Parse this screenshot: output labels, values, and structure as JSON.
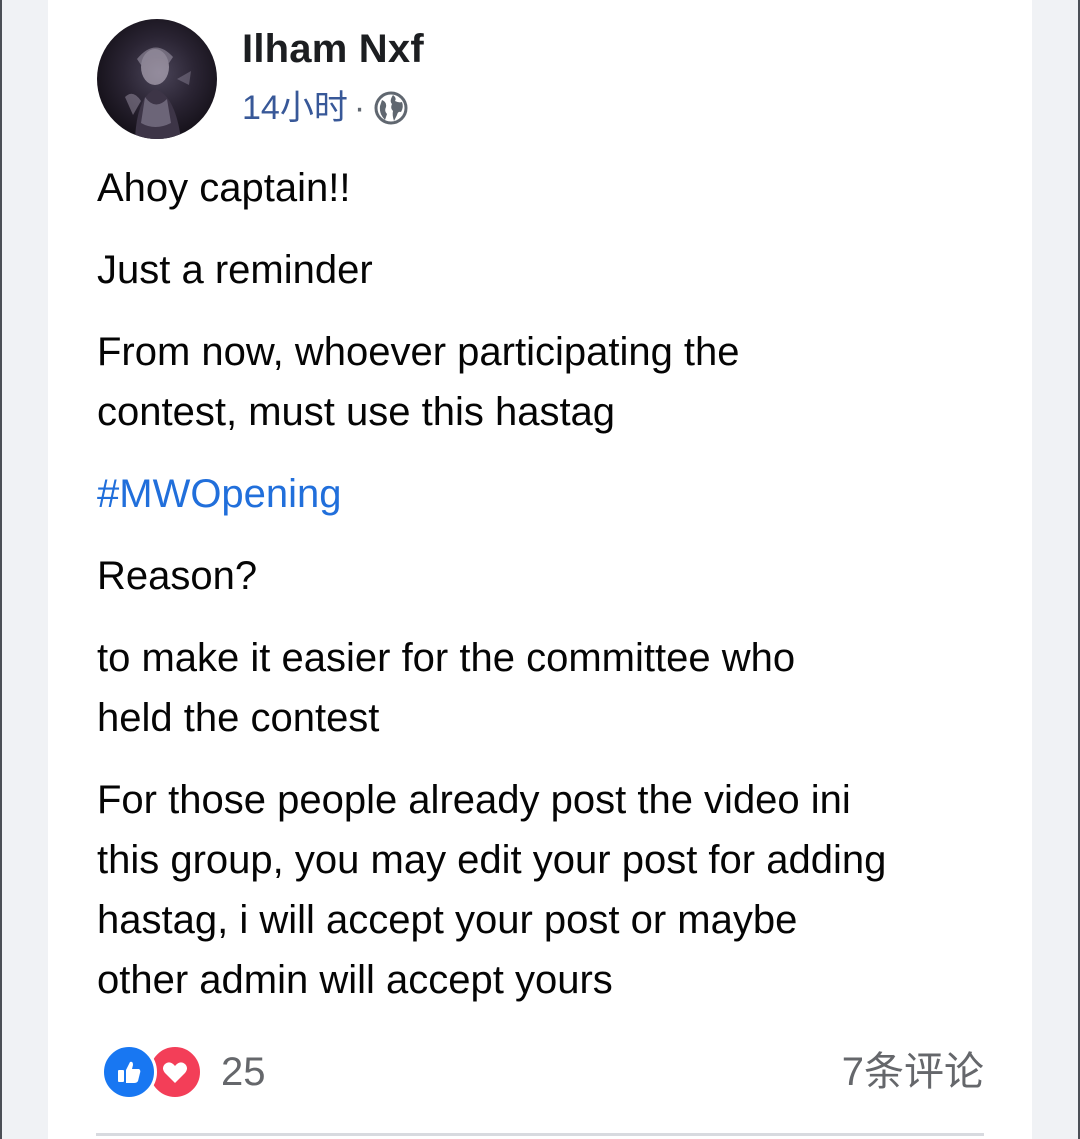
{
  "post": {
    "author": "Ilham Nxf",
    "time": "14小时",
    "separator": "·",
    "privacy_icon": "globe-icon",
    "avatar_icon": "profile-avatar",
    "paragraphs": {
      "p1": "Ahoy captain!!",
      "p2": "Just a reminder",
      "p3_line1": "From now, whoever participating the",
      "p3_line2": "contest, must use this hastag",
      "hashtag": "#MWOpening",
      "p5": "Reason?",
      "p6_line1": "to make it easier for the committee who",
      "p6_line2": "held the contest",
      "p7_line1": "For those people already post the video ini",
      "p7_line2": "this group, you may edit your post for adding",
      "p7_line3": "hastag, i will accept your post or maybe",
      "p7_line4": "other admin will accept yours"
    }
  },
  "footer": {
    "reaction_icons": [
      "like-icon",
      "love-icon"
    ],
    "reaction_count": "25",
    "comments": "7条评论"
  },
  "colors": {
    "link": "#216fdb",
    "meta": "#385898",
    "like": "#1877f2",
    "love": "#f33e58",
    "secondary_text": "#65676b"
  }
}
